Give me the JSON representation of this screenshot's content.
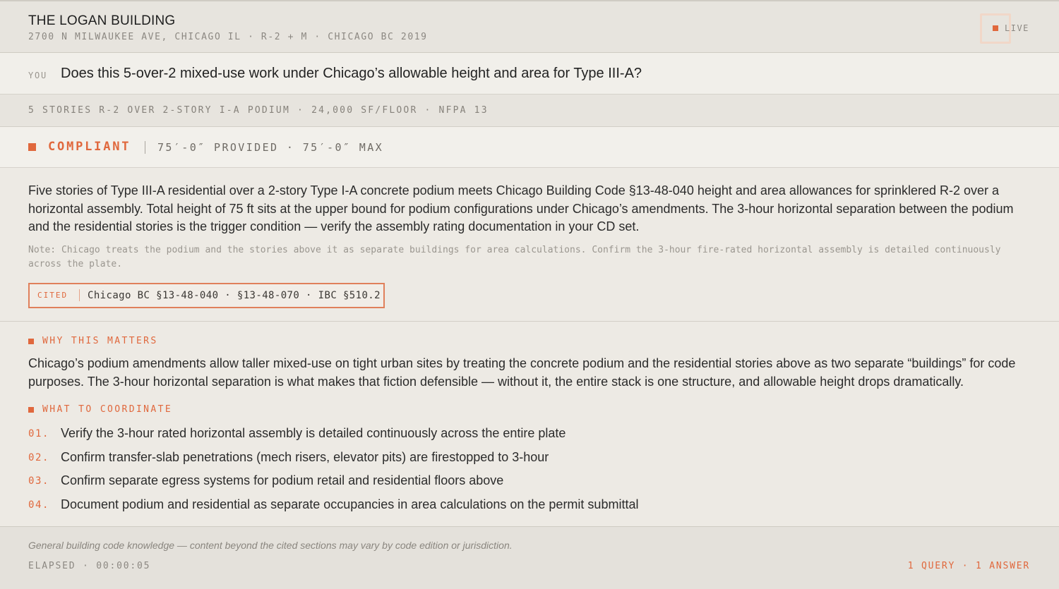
{
  "header": {
    "title": "THE LOGAN BUILDING",
    "subtitle": "2700 N MILWAUKEE AVE, CHICAGO IL · R-2 + M · CHICAGO BC 2019",
    "live_label": "LIVE"
  },
  "query": {
    "speaker_label": "YOU",
    "question": "Does this 5-over-2 mixed-use work under Chicago’s allowable height and area for Type III-A?"
  },
  "specs": "5 STORIES R-2 OVER 2-STORY I-A PODIUM · 24,000 SF/FLOOR · NFPA 13",
  "verdict": {
    "status": "COMPLIANT",
    "detail": "75′-0″ PROVIDED · 75′-0″ MAX"
  },
  "answer": {
    "body": "Five stories of Type III-A residential over a 2-story Type I-A concrete podium meets Chicago Building Code §13-48-040 height and area allowances for sprinklered R-2 over a horizontal assembly. Total height of 75 ft sits at the upper bound for podium configurations under Chicago’s amendments. The 3-hour horizontal separation between the podium and the residential stories is the trigger condition — verify the assembly rating documentation in your CD set.",
    "note": "Note: Chicago treats the podium and the stories above it as separate buildings for area calculations. Confirm the 3-hour fire-rated horizontal assembly is detailed continuously across the plate.",
    "cited_label": "CITED",
    "cited_refs": "Chicago BC §13-48-040 · §13-48-070 · IBC §510.2"
  },
  "why": {
    "heading": "WHY THIS MATTERS",
    "body": "Chicago’s podium amendments allow taller mixed-use on tight urban sites by treating the concrete podium and the residential stories above as two separate “buildings” for code purposes. The 3-hour horizontal separation is what makes that fiction defensible — without it, the entire stack is one structure, and allowable height drops dramatically."
  },
  "coordinate": {
    "heading": "WHAT TO COORDINATE",
    "items": [
      {
        "num": "01.",
        "text": "Verify the 3-hour rated horizontal assembly is detailed continuously across the entire plate"
      },
      {
        "num": "02.",
        "text": "Confirm transfer-slab penetrations (mech risers, elevator pits) are firestopped to 3-hour"
      },
      {
        "num": "03.",
        "text": "Confirm separate egress systems for podium retail and residential floors above"
      },
      {
        "num": "04.",
        "text": "Document podium and residential as separate occupancies in area calculations on the permit submittal"
      }
    ]
  },
  "footer": {
    "disclaimer": "General building code knowledge — content beyond the cited sections may vary by code edition or jurisdiction.",
    "elapsed": "ELAPSED · 00:00:05",
    "stats": "1 QUERY · 1 ANSWER"
  },
  "colors": {
    "accent": "#e0683d",
    "background": "#edeae4",
    "text": "#2b2b2b",
    "muted": "#8c8882"
  }
}
